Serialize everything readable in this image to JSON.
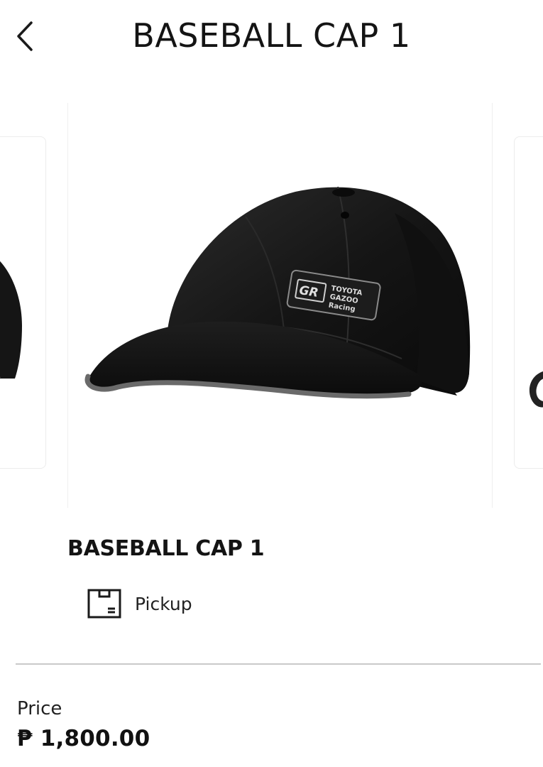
{
  "header": {
    "title": "BASEBALL CAP 1",
    "back_icon": "chevron-left-icon"
  },
  "carousel": {
    "current_image": "black-baseball-cap-photo",
    "badge_text": [
      "GR",
      "TOYOTA",
      "GAZOO",
      "Racing"
    ]
  },
  "product": {
    "title": "BASEBALL CAP 1",
    "delivery_icon": "package-box-icon",
    "delivery_method": "Pickup"
  },
  "price": {
    "label": "Price",
    "value": "₱ 1,800.00"
  },
  "colors": {
    "text": "#141414",
    "divider": "#c9c9c9",
    "cap": "#141414"
  }
}
